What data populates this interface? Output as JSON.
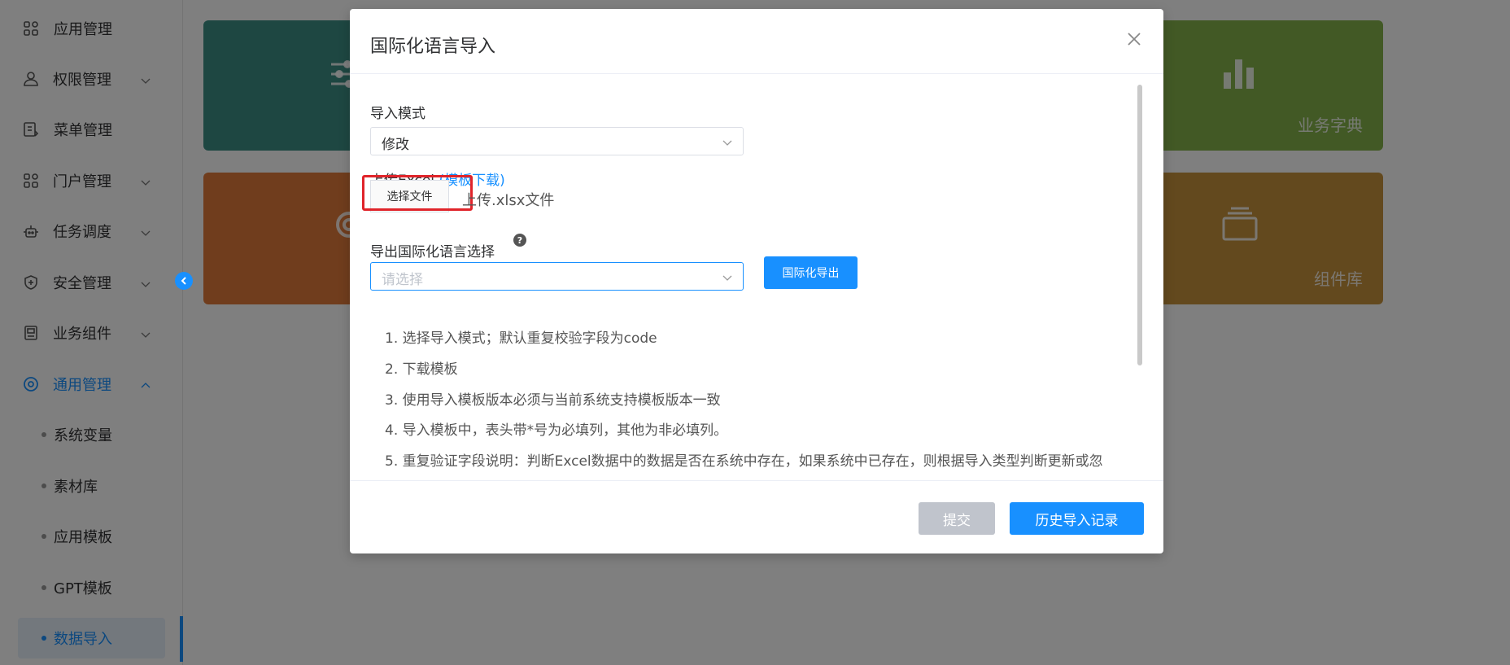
{
  "sidebar": {
    "items": [
      {
        "label": "应用管理",
        "icon": "grid-icon"
      },
      {
        "label": "权限管理",
        "icon": "user-icon"
      },
      {
        "label": "菜单管理",
        "icon": "menu-doc-icon"
      },
      {
        "label": "门户管理",
        "icon": "grid-icon"
      },
      {
        "label": "任务调度",
        "icon": "robot-icon"
      },
      {
        "label": "安全管理",
        "icon": "shield-icon"
      },
      {
        "label": "业务组件",
        "icon": "component-icon"
      },
      {
        "label": "通用管理",
        "icon": "target-icon"
      }
    ],
    "sub_items": [
      "系统变量",
      "素材库",
      "应用模板",
      "GPT模板",
      "数据导入"
    ],
    "selected_sub": "数据导入"
  },
  "cards": {
    "c2_label": "业务字典",
    "c4_label": "组件库"
  },
  "modal": {
    "title": "国际化语言导入",
    "import_mode_label": "导入模式",
    "import_mode_value": "修改",
    "upload_label": "上传Excel",
    "template_link": "(模板下载)",
    "choose_file_button": "选择文件",
    "file_hint": "上传.xlsx文件",
    "export_lang_label": "导出国际化语言选择",
    "export_lang_placeholder": "请选择",
    "export_button": "国际化导出",
    "instructions": [
      "1. 选择导入模式；默认重复校验字段为code",
      "2. 下载模板",
      "3. 使用导入模板版本必须与当前系统支持模板版本一致",
      "4. 导入模板中，表头带*号为必填列，其他为非必填列。",
      "5. 重复验证字段说明：判断Excel数据中的数据是否在系统中存在，如果系统中已存在，则根据导入类型判断更新或忽"
    ],
    "submit_button": "提交",
    "history_button": "历史导入记录"
  },
  "colors": {
    "primary": "#1890ff",
    "highlight_box": "#e0242a",
    "overlay": "rgba(0,0,0,0.5)"
  }
}
